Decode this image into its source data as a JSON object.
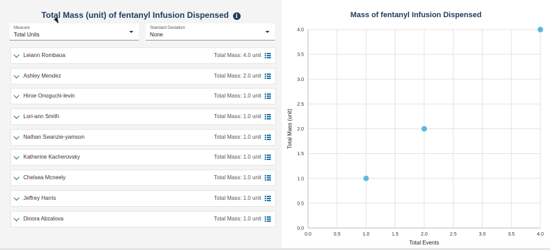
{
  "left_panel": {
    "title": "Total Mass (unit) of fentanyl Infusion Dispensed",
    "info_icon": "info-icon",
    "measure": {
      "label": "Measure",
      "value": "Total Units"
    },
    "std_dev": {
      "label": "Standard Deviation",
      "value": "None"
    },
    "rows": [
      {
        "name": "Leiann Rombaoa",
        "mass": "Total Mass: 4.0 unit"
      },
      {
        "name": "Ashley Mendez",
        "mass": "Total Mass: 2.0 unit"
      },
      {
        "name": "Hiroe Onoguchi-levin",
        "mass": "Total Mass: 1.0 unit"
      },
      {
        "name": "Lori-ann Smith",
        "mass": "Total Mass: 1.0 unit"
      },
      {
        "name": "Nathan Swanzie-yamson",
        "mass": "Total Mass: 1.0 unit"
      },
      {
        "name": "Katherine Kacherovsky",
        "mass": "Total Mass: 1.0 unit"
      },
      {
        "name": "Chelsea Mcneely",
        "mass": "Total Mass: 1.0 unit"
      },
      {
        "name": "Jeffrey Harris",
        "mass": "Total Mass: 1.0 unit"
      },
      {
        "name": "Dinora Abzalova",
        "mass": "Total Mass: 1.0 unit"
      }
    ]
  },
  "chart_data": {
    "type": "scatter",
    "title": "Mass of fentanyl Infusion Dispensed",
    "xlabel": "Total Events",
    "ylabel": "Total Mass (unit)",
    "xlim": [
      0,
      4
    ],
    "ylim": [
      0,
      4
    ],
    "xticks": [
      "0.0",
      "0.5",
      "1.0",
      "1.5",
      "2.0",
      "2.5",
      "3.0",
      "3.5",
      "4.0"
    ],
    "yticks": [
      "0.0",
      "0.5",
      "1.0",
      "1.5",
      "2.0",
      "2.5",
      "3.0",
      "3.5",
      "4.0"
    ],
    "grid": true,
    "color": "#5bb8e0",
    "points": [
      {
        "x": 1,
        "y": 1
      },
      {
        "x": 2,
        "y": 2
      },
      {
        "x": 4,
        "y": 4
      }
    ]
  }
}
